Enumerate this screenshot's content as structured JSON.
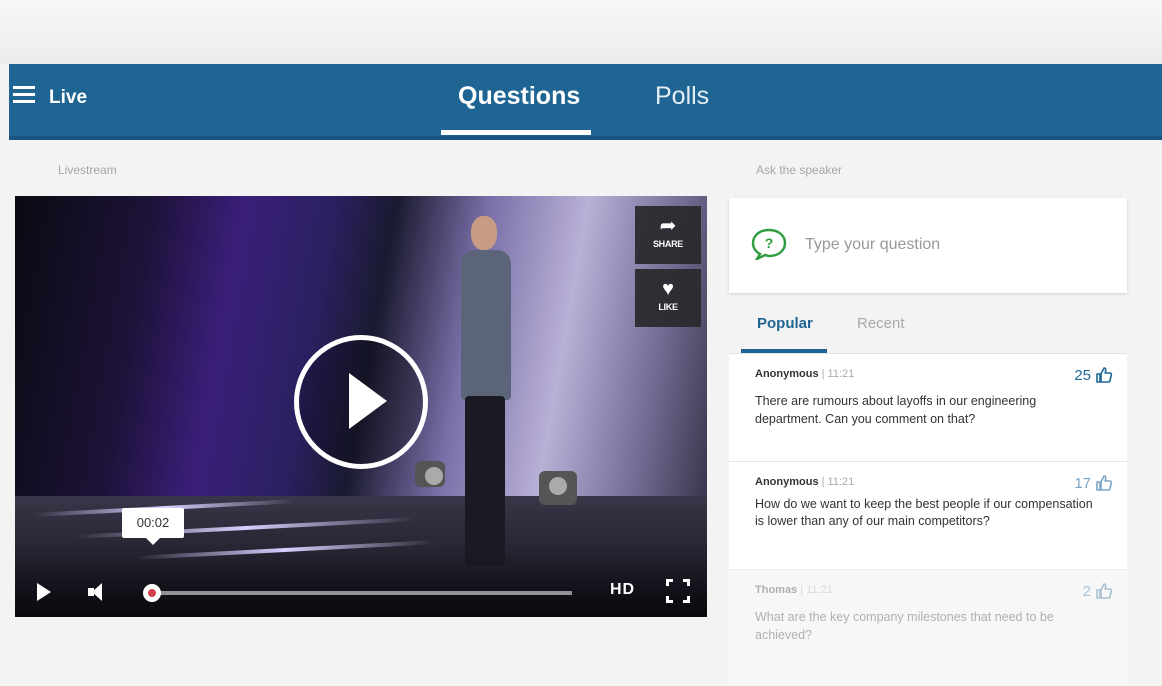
{
  "header": {
    "title": "Live",
    "tabs": [
      {
        "label": "Questions",
        "active": true
      },
      {
        "label": "Polls",
        "active": false
      }
    ]
  },
  "livestream": {
    "label": "Livestream",
    "share_label": "SHARE",
    "like_label": "LIKE",
    "current_time": "00:02",
    "quality_label": "HD",
    "progress_fraction": 0.0
  },
  "ask": {
    "label": "Ask the speaker",
    "placeholder": "Type your question"
  },
  "question_tabs": [
    {
      "label": "Popular",
      "active": true
    },
    {
      "label": "Recent",
      "active": false
    }
  ],
  "questions": [
    {
      "author": "Anonymous",
      "time": "11:21",
      "votes": "25",
      "text": "There are rumours about layoffs in our engineering department. Can you comment on that?"
    },
    {
      "author": "Anonymous",
      "time": "11:21",
      "votes": "17",
      "text": "How do we want to keep the best people if our compensation is lower than any of our main competitors?"
    },
    {
      "author": "Thomas",
      "time": "11:21",
      "votes": "2",
      "text": "What are the key company milestones that need to be achieved?"
    }
  ],
  "colors": {
    "brand": "#1f6594",
    "accent_icon": "#2e9c3f",
    "progress_knob": "#d1404c"
  }
}
